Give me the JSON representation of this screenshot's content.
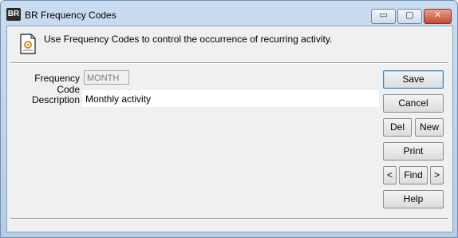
{
  "window": {
    "icon_text": "BR",
    "title": "BR Frequency Codes",
    "minimize_glyph": "▭",
    "maximize_glyph": "▢",
    "close_glyph": "✕"
  },
  "header": {
    "message": "Use Frequency Codes to control the occurrence of recurring activity."
  },
  "form": {
    "frequency_code_label": "Frequency Code",
    "frequency_code_value": "MONTH",
    "description_label": "Description",
    "description_value": "Monthly activity"
  },
  "buttons": {
    "save": "Save",
    "cancel": "Cancel",
    "del": "Del",
    "new": "New",
    "print": "Print",
    "prev": "<",
    "find": "Find",
    "next": ">",
    "help": "Help"
  },
  "icons": {
    "app": "br-app-icon",
    "header": "document-gear-icon"
  }
}
